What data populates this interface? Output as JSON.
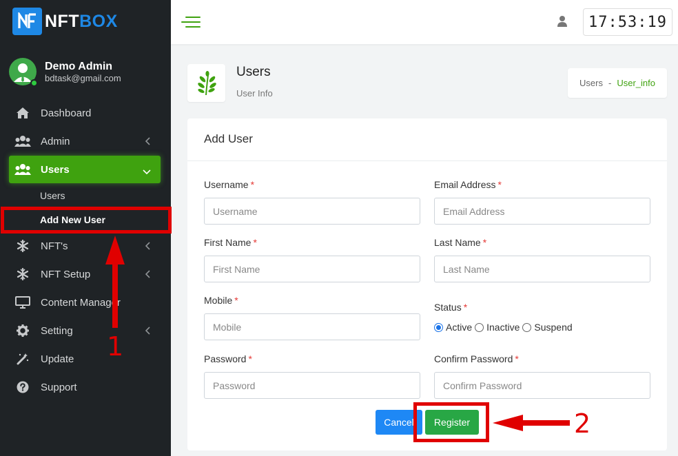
{
  "brand": {
    "name_part1": "NFT",
    "name_part2": "BOX"
  },
  "profile": {
    "name": "Demo Admin",
    "email": "bdtask@gmail.com"
  },
  "nav": {
    "dashboard": "Dashboard",
    "admin": "Admin",
    "users": "Users",
    "users_sub": {
      "users": "Users",
      "add_new_user": "Add New User"
    },
    "nfts": "NFT's",
    "nft_setup": "NFT Setup",
    "content_manager": "Content Manager",
    "setting": "Setting",
    "update": "Update",
    "support": "Support"
  },
  "topbar": {
    "clock": "17:53:19"
  },
  "page": {
    "title": "Users",
    "subtitle": "User Info",
    "breadcrumb": {
      "home": "Users",
      "separator": "-",
      "current": "User_info"
    }
  },
  "form": {
    "title": "Add User",
    "username": {
      "label": "Username",
      "placeholder": "Username"
    },
    "email": {
      "label": "Email Address",
      "placeholder": "Email Address"
    },
    "first_name": {
      "label": "First Name",
      "placeholder": "First Name"
    },
    "last_name": {
      "label": "Last Name",
      "placeholder": "Last Name"
    },
    "mobile": {
      "label": "Mobile",
      "placeholder": "Mobile"
    },
    "status": {
      "label": "Status",
      "options": [
        "Active",
        "Inactive",
        "Suspend"
      ],
      "selected": "Active"
    },
    "password": {
      "label": "Password",
      "placeholder": "Password"
    },
    "confirm_password": {
      "label": "Confirm Password",
      "placeholder": "Confirm Password"
    },
    "required_mark": "*",
    "cancel_label": "Cancel",
    "register_label": "Register"
  },
  "annotations": {
    "step1": "1",
    "step2": "2"
  },
  "colors": {
    "sidebar_bg": "#1f2326",
    "accent_green": "#3fa20f",
    "brand_blue": "#1e88e5",
    "annotation_red": "#e00000"
  }
}
